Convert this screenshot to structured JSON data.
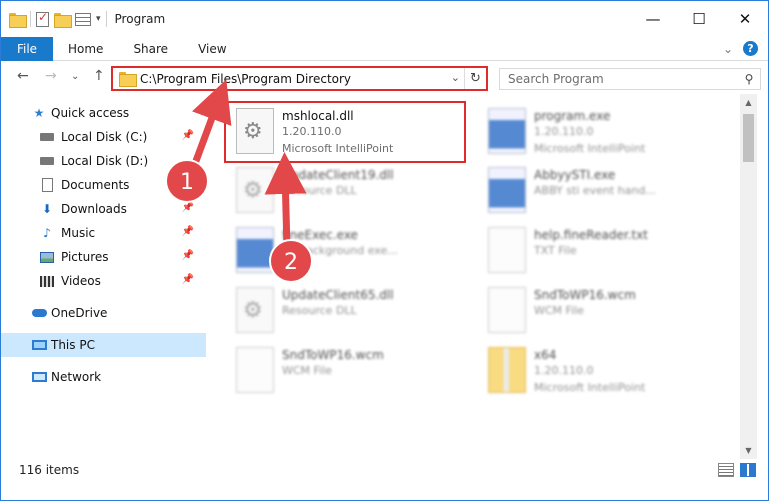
{
  "window": {
    "title": "Program",
    "buttons": {
      "minimize": "—",
      "maximize": "☐",
      "close": "✕"
    }
  },
  "ribbon": {
    "tabs": [
      {
        "label": "File"
      },
      {
        "label": "Home"
      },
      {
        "label": "Share"
      },
      {
        "label": "View"
      }
    ],
    "expand_glyph": "⌄",
    "help_glyph": "?"
  },
  "nav": {
    "back": "←",
    "forward": "→",
    "recent": "⌄",
    "up": "↑"
  },
  "address": {
    "path": "C:\\Program Files\\Program Directory",
    "dropdown_glyph": "⌄",
    "refresh_glyph": "↻"
  },
  "search": {
    "placeholder": "Search Program",
    "icon": "search-icon"
  },
  "sidebar": {
    "items": [
      {
        "label": "Quick access",
        "icon": "star-icon"
      },
      {
        "label": "Local Disk (C:)",
        "icon": "drive-icon",
        "pinned": true
      },
      {
        "label": "Local Disk (D:)",
        "icon": "drive-icon",
        "pinned": false
      },
      {
        "label": "Documents",
        "icon": "documents-icon",
        "pinned": true
      },
      {
        "label": "Downloads",
        "icon": "download-icon",
        "pinned": true
      },
      {
        "label": "Music",
        "icon": "music-icon",
        "pinned": true
      },
      {
        "label": "Pictures",
        "icon": "pictures-icon",
        "pinned": true
      },
      {
        "label": "Videos",
        "icon": "videos-icon",
        "pinned": true
      },
      {
        "label": "OneDrive",
        "icon": "cloud-icon"
      },
      {
        "label": "This PC",
        "icon": "computer-icon",
        "selected": true
      },
      {
        "label": "Network",
        "icon": "network-icon"
      }
    ],
    "pin_glyph": "📌"
  },
  "files": [
    {
      "name": "mshlocal.dll",
      "line2": "1.20.110.0",
      "line3": "Microsoft IntelliPoint",
      "icon": "dll-gear-icon",
      "highlighted": true
    },
    {
      "name": "program.exe",
      "line2": "1.20.110.0",
      "line3": "Microsoft IntelliPoint",
      "icon": "app-icon"
    },
    {
      "name": "UpdateClient19.dll",
      "line2": "Resource DLL",
      "line3": "",
      "icon": "dll-gear-icon"
    },
    {
      "name": "AbbyySTI.exe",
      "line2": "ABBY sti event hand...",
      "line3": "",
      "icon": "app-icon"
    },
    {
      "name": "fineExec.exe",
      "line2": "BY background exe...",
      "line3": "",
      "icon": "app-icon"
    },
    {
      "name": "help.fineReader.txt",
      "line2": "TXT File",
      "line3": "",
      "icon": "text-file-icon"
    },
    {
      "name": "UpdateClient65.dll",
      "line2": "Resource DLL",
      "line3": "",
      "icon": "dll-gear-icon"
    },
    {
      "name": "SndToWP16.wcm",
      "line2": "WCM File",
      "line3": "",
      "icon": "file-icon"
    },
    {
      "name": "SndToWP16.wcm",
      "line2": "WCM File",
      "line3": "",
      "icon": "file-icon"
    },
    {
      "name": "x64",
      "line2": "1.20.110.0",
      "line3": "Microsoft IntelliPoint",
      "icon": "folder-zip-icon"
    }
  ],
  "status": {
    "items_count": "116 items"
  },
  "annotations": [
    {
      "label": "1"
    },
    {
      "label": "2"
    }
  ],
  "colors": {
    "accent": "#1979ca",
    "highlight": "#de2b2b",
    "selected_bg": "#cce8ff"
  }
}
